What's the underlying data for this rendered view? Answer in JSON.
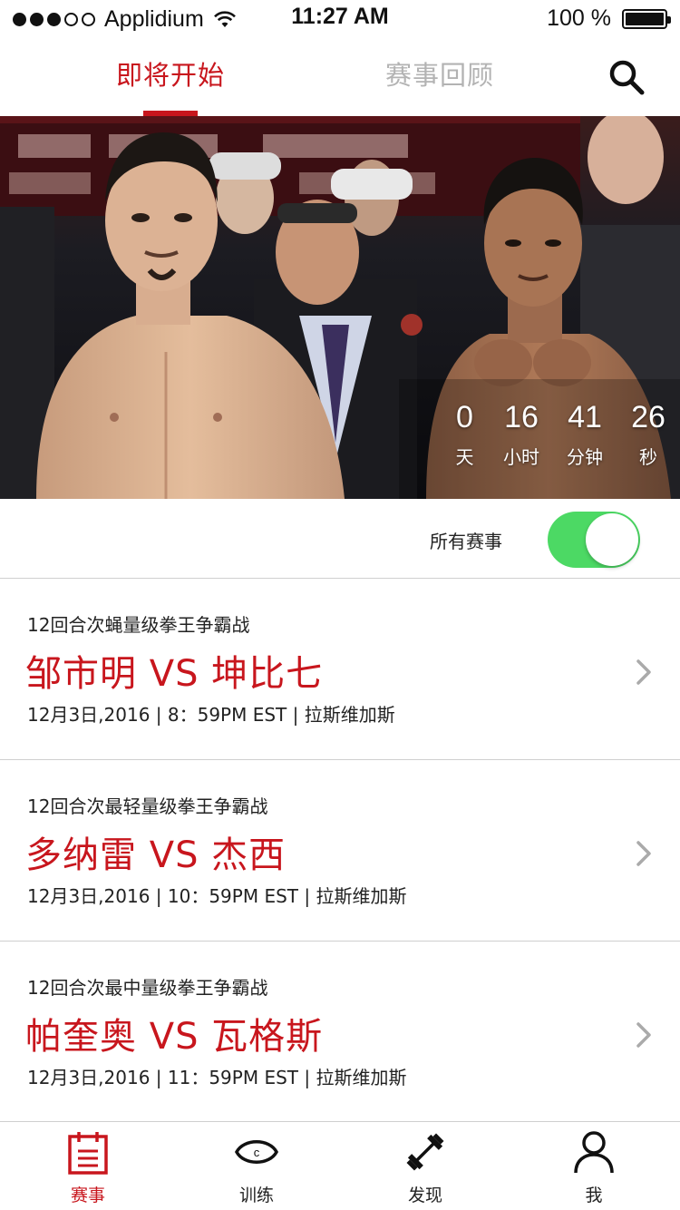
{
  "status_bar": {
    "carrier": "Applidium",
    "time": "11:27 AM",
    "battery": "100 %",
    "battery_level": 1.0,
    "signal_bars_filled": 3,
    "signal_bars_total": 5
  },
  "header": {
    "tabs": [
      {
        "label": "即将开始",
        "active": true
      },
      {
        "label": "赛事回顾",
        "active": false
      }
    ],
    "search_icon": "search-icon"
  },
  "hero": {
    "countdown": [
      {
        "value": "0",
        "label": "天"
      },
      {
        "value": "16",
        "label": "小时"
      },
      {
        "value": "41",
        "label": "分钟"
      },
      {
        "value": "26",
        "label": "秒"
      }
    ]
  },
  "filter": {
    "label": "所有赛事",
    "toggle_on": true
  },
  "events": [
    {
      "subtitle": "12回合次蝇量级拳王争霸战",
      "title": "邹市明 VS 坤比七",
      "meta": "12月3日,2016  | 8：59PM EST | 拉斯维加斯"
    },
    {
      "subtitle": "12回合次最轻量级拳王争霸战",
      "title": "多纳雷 VS 杰西",
      "meta": "12月3日,2016  | 10：59PM EST | 拉斯维加斯"
    },
    {
      "subtitle": "12回合次最中量级拳王争霸战",
      "title": "帕奎奥 VS 瓦格斯",
      "meta": "12月3日,2016  | 11：59PM EST | 拉斯维加斯"
    }
  ],
  "bottom_nav": [
    {
      "label": "赛事",
      "icon": "calendar-icon",
      "active": true
    },
    {
      "label": "训练",
      "icon": "eye-c-icon",
      "active": false
    },
    {
      "label": "发现",
      "icon": "dumbbell-icon",
      "active": false
    },
    {
      "label": "我",
      "icon": "user-icon",
      "active": false
    }
  ],
  "colors": {
    "accent": "#c8161d",
    "toggle_on": "#4cd964",
    "inactive_tab": "#b3b3b3"
  }
}
